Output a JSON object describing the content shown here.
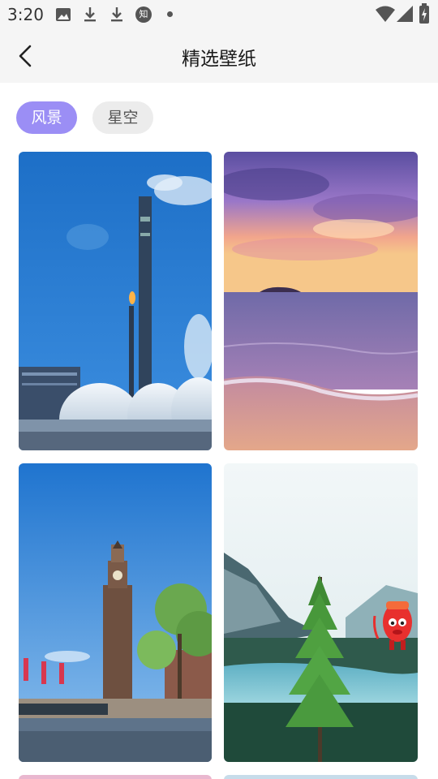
{
  "status_bar": {
    "time": "3:20",
    "left_icons": [
      "image-icon",
      "download-icon",
      "download-icon",
      "zhihu-icon",
      "dot-icon"
    ],
    "zhihu_char": "知",
    "right_icons": [
      "wifi-icon",
      "signal-icon",
      "battery-charging-icon"
    ]
  },
  "header": {
    "title": "精选壁纸",
    "back_icon": "chevron-left-icon"
  },
  "tabs": [
    {
      "label": "风景",
      "active": true
    },
    {
      "label": "星空",
      "active": false
    }
  ],
  "wallpapers": [
    {
      "name": "industrial-chimney-scene"
    },
    {
      "name": "purple-sunset-beach"
    },
    {
      "name": "clock-tower-canal"
    },
    {
      "name": "pine-tree-lake-mountains"
    }
  ],
  "floating_mascot": {
    "icon": "red-lucky-bag-mascot-icon"
  },
  "colors": {
    "accent": "#9b8ef5",
    "tab_inactive_bg": "#ececec",
    "bar_bg": "#f5f5f5"
  }
}
